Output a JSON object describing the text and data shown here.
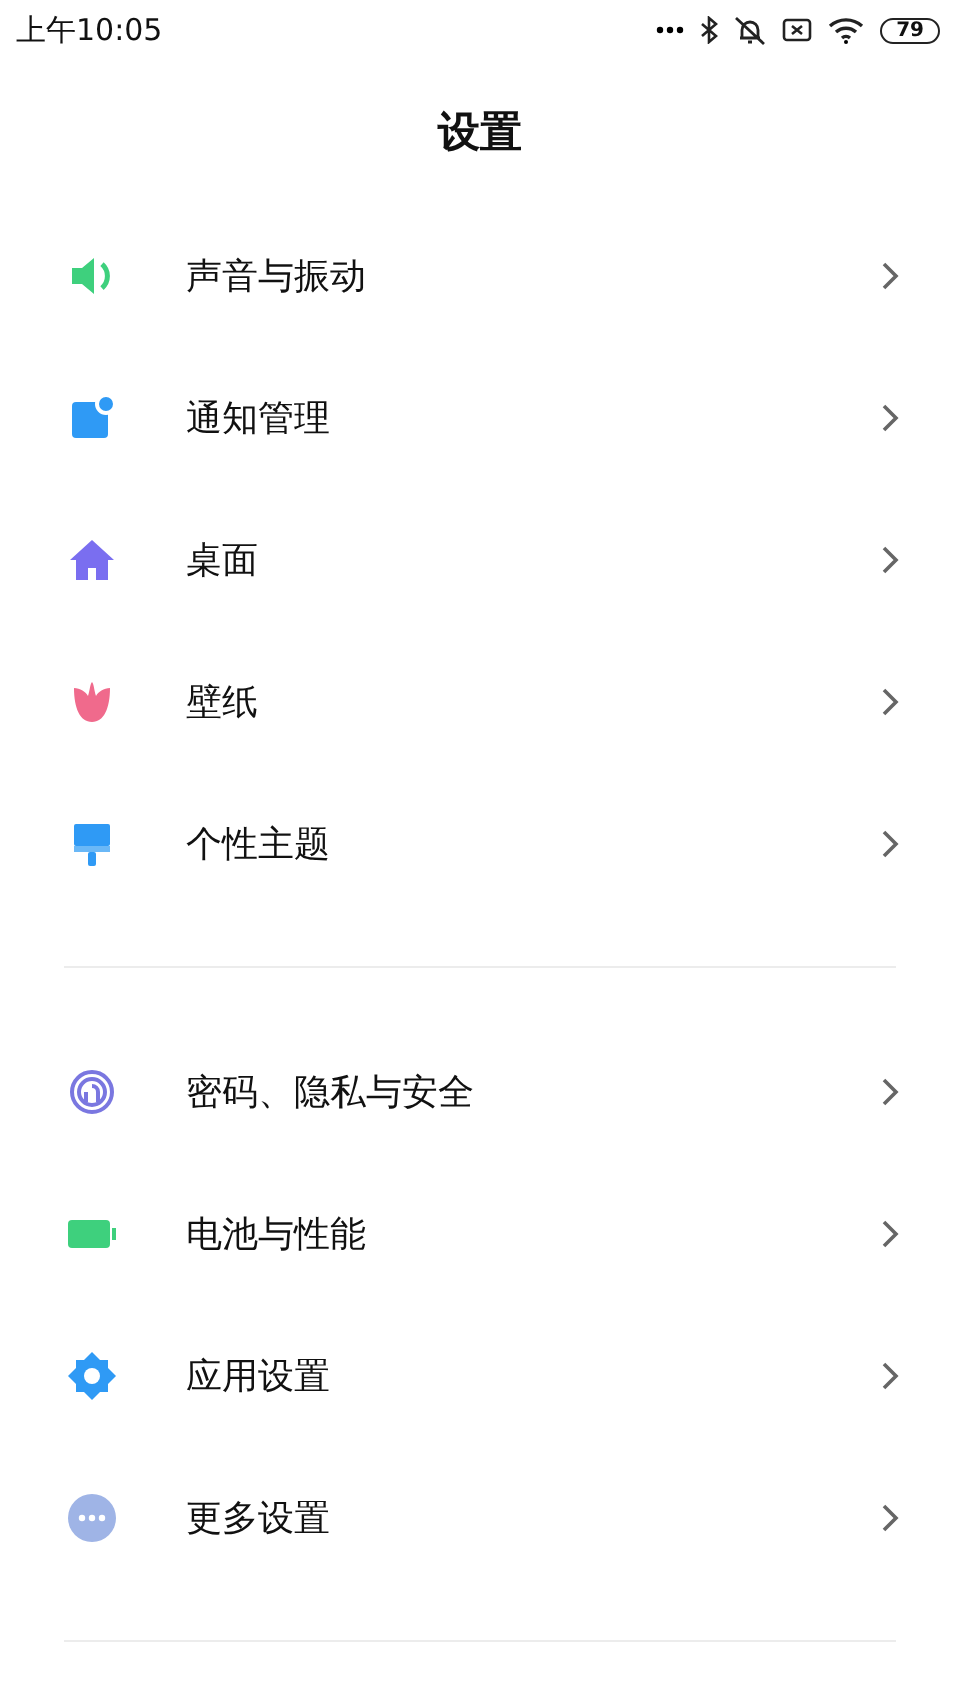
{
  "status_bar": {
    "time": "上午10:05",
    "battery": "79"
  },
  "title": "设置",
  "groups": [
    {
      "items": [
        {
          "kind": "sound",
          "label": "声音与振动"
        },
        {
          "kind": "notification",
          "label": "通知管理"
        },
        {
          "kind": "home",
          "label": "桌面"
        },
        {
          "kind": "flower",
          "label": "壁纸"
        },
        {
          "kind": "brush",
          "label": "个性主题"
        }
      ]
    },
    {
      "items": [
        {
          "kind": "fingerprint",
          "label": "密码、隐私与安全"
        },
        {
          "kind": "battery",
          "label": "电池与性能"
        },
        {
          "kind": "gear",
          "label": "应用设置"
        },
        {
          "kind": "more",
          "label": "更多设置"
        }
      ]
    }
  ]
}
